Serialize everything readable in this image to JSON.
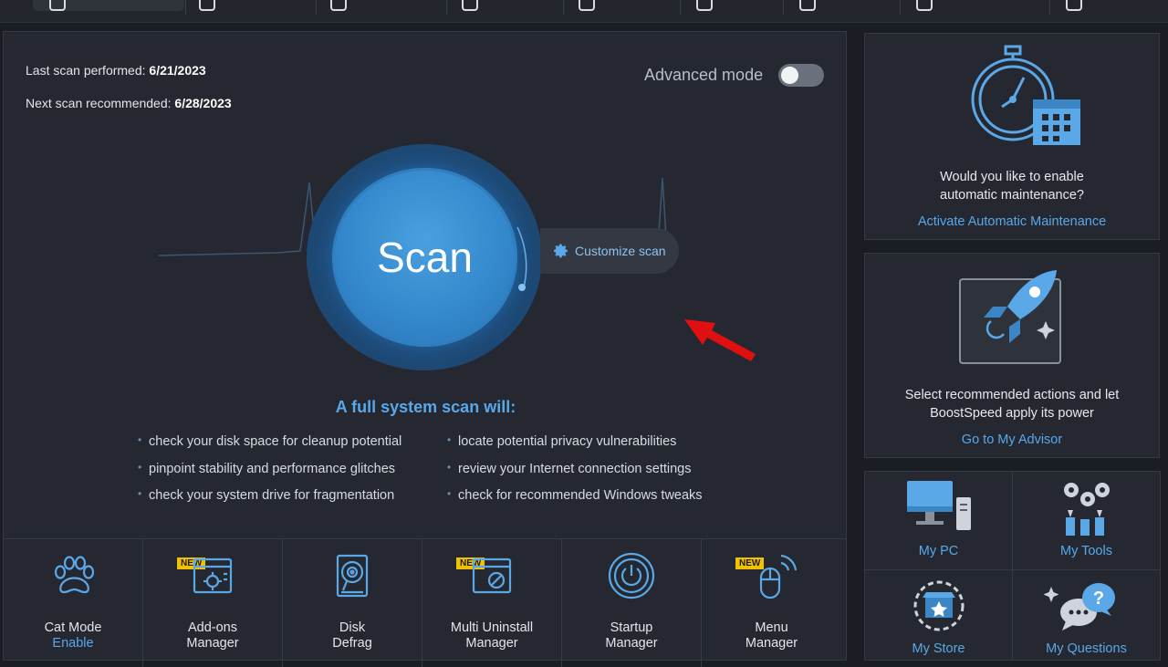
{
  "scan_info": {
    "last_label": "Last scan performed:",
    "last_date": "6/21/2023",
    "next_label": "Next scan recommended:",
    "next_date": "6/28/2023"
  },
  "advanced_mode": {
    "label": "Advanced mode",
    "enabled": false
  },
  "scan_button": {
    "label": "Scan"
  },
  "customize": {
    "label": "Customize scan",
    "icon": "gear-icon"
  },
  "headline": "A full system scan will:",
  "bullets_left": [
    "check your disk space for cleanup potential",
    "pinpoint stability and performance glitches",
    "check your system drive for fragmentation"
  ],
  "bullets_right": [
    "locate potential privacy vulnerabilities",
    "review your Internet connection settings",
    "check for recommended Windows tweaks"
  ],
  "tools": [
    {
      "line1": "Cat Mode",
      "line2": "Enable",
      "icon": "paw-icon",
      "badge": ""
    },
    {
      "line1": "Add-ons",
      "line2": "Manager",
      "icon": "addons-icon",
      "badge": "NEW"
    },
    {
      "line1": "Disk",
      "line2": "Defrag",
      "icon": "disk-icon",
      "badge": ""
    },
    {
      "line1": "Multi Uninstall",
      "line2": "Manager",
      "icon": "uninstall-icon",
      "badge": "NEW"
    },
    {
      "line1": "Startup",
      "line2": "Manager",
      "icon": "power-icon",
      "badge": ""
    },
    {
      "line1": "Menu",
      "line2": "Manager",
      "icon": "mouse-icon",
      "badge": "NEW"
    }
  ],
  "maintenance_card": {
    "text": "Would you like to enable automatic maintenance?",
    "link": "Activate Automatic Maintenance",
    "icon": "stopwatch-calendar-icon"
  },
  "advisor_card": {
    "text": "Select recommended actions and let BoostSpeed apply its power",
    "link": "Go to My Advisor",
    "icon": "rocket-icon"
  },
  "grid": [
    {
      "label": "My PC",
      "icon": "computer-icon"
    },
    {
      "label": "My Tools",
      "icon": "tools-icon"
    },
    {
      "label": "My Store",
      "icon": "store-icon"
    },
    {
      "label": "My Questions",
      "icon": "questions-icon"
    }
  ],
  "colors": {
    "accent": "#58a8ea",
    "badge": "#f2c200",
    "arrow": "#e01010"
  }
}
